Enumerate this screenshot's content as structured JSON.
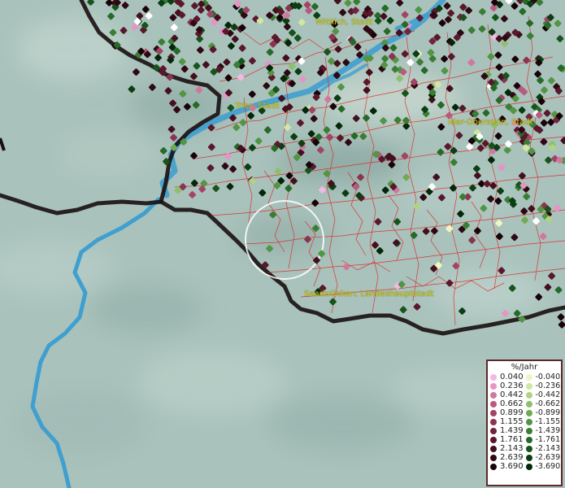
{
  "map": {
    "cities": [
      {
        "name": "Wittlich, Stadt"
      },
      {
        "name": "Trier, Stadt"
      },
      {
        "name": "Idar-Oberstein, Stadt"
      },
      {
        "name": "Saarbrücken, Landeshauptstadt"
      }
    ],
    "colors": {
      "terrain": "#a9c2bc",
      "river": "#3f9fcf",
      "border": "#1a0f10",
      "districts": "#e02020",
      "city_label": "#d8d400",
      "highlight_circle": "#ffffff"
    }
  },
  "legend": {
    "title": "%/Jahr",
    "positive": [
      {
        "value": "0.040",
        "color": "#f4b8e4"
      },
      {
        "value": "0.236",
        "color": "#e694c6"
      },
      {
        "value": "0.442",
        "color": "#d0779f"
      },
      {
        "value": "0.662",
        "color": "#b85a7f"
      },
      {
        "value": "0.899",
        "color": "#a14466"
      },
      {
        "value": "1.155",
        "color": "#8a3450"
      },
      {
        "value": "1.439",
        "color": "#72243c"
      },
      {
        "value": "1.761",
        "color": "#5a182c"
      },
      {
        "value": "2.143",
        "color": "#440f1e"
      },
      {
        "value": "2.639",
        "color": "#2e0812"
      },
      {
        "value": "3.690",
        "color": "#1a0308"
      }
    ],
    "negative": [
      {
        "value": "-0.040",
        "color": "#eef6c0"
      },
      {
        "value": "-0.236",
        "color": "#cfe7a0"
      },
      {
        "value": "-0.442",
        "color": "#aed483"
      },
      {
        "value": "-0.662",
        "color": "#8ec06a"
      },
      {
        "value": "-0.899",
        "color": "#70ab52"
      },
      {
        "value": "-1.155",
        "color": "#529542"
      },
      {
        "value": "-1.439",
        "color": "#3a7e34"
      },
      {
        "value": "-1.761",
        "color": "#266a28"
      },
      {
        "value": "-2.143",
        "color": "#17541c"
      },
      {
        "value": "-2.639",
        "color": "#0b3e12"
      },
      {
        "value": "-3.690",
        "color": "#032708"
      }
    ]
  }
}
